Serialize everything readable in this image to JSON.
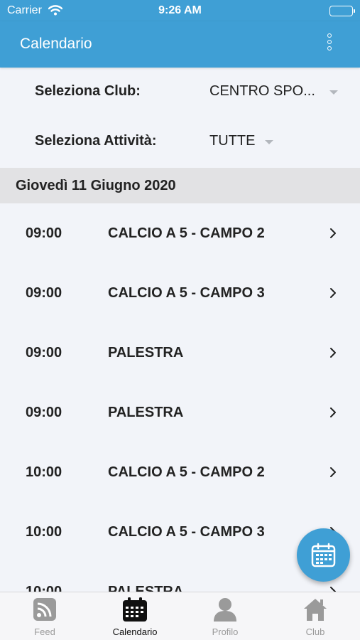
{
  "status_bar": {
    "carrier": "Carrier",
    "time": "9:26 AM"
  },
  "header": {
    "title": "Calendario",
    "menu_icon": "more-vertical-icon"
  },
  "filters": {
    "club": {
      "label": "Seleziona Club:",
      "value": "CENTRO SPO..."
    },
    "activity": {
      "label": "Seleziona Attività:",
      "value": "TUTTE"
    }
  },
  "date_header": "Giovedì 11 Giugno 2020",
  "events": [
    {
      "time": "09:00",
      "activity": "CALCIO A 5 - CAMPO 2"
    },
    {
      "time": "09:00",
      "activity": "CALCIO A 5 - CAMPO 3"
    },
    {
      "time": "09:00",
      "activity": "PALESTRA"
    },
    {
      "time": "09:00",
      "activity": "PALESTRA"
    },
    {
      "time": "10:00",
      "activity": "CALCIO A 5 - CAMPO 2"
    },
    {
      "time": "10:00",
      "activity": "CALCIO A 5 - CAMPO 3"
    },
    {
      "time": "10:00",
      "activity": "PALESTRA"
    }
  ],
  "fab_icon": "calendar-icon",
  "tabs": [
    {
      "label": "Feed",
      "icon": "feed-icon",
      "active": false
    },
    {
      "label": "Calendario",
      "icon": "calendar-icon",
      "active": true
    },
    {
      "label": "Profilo",
      "icon": "profile-icon",
      "active": false
    },
    {
      "label": "Club",
      "icon": "home-icon",
      "active": false
    }
  ],
  "colors": {
    "primary": "#3f9fd5",
    "background": "#f2f4f9",
    "date_header_bg": "#e2e2e4",
    "tab_inactive": "#9a9a9a"
  }
}
